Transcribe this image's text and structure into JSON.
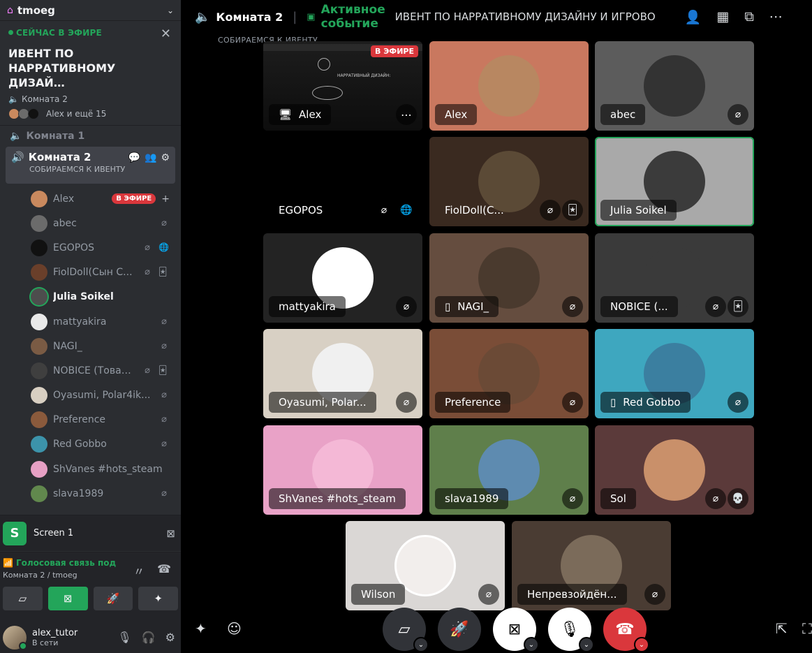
{
  "server": {
    "name": "tmoeg"
  },
  "live": {
    "tag": "СЕЙЧАС В ЭФИРЕ",
    "title": "ИВЕНТ ПО НАРРАТИВНОМУ ДИЗАЙ…",
    "room": "Комната 2",
    "people": "Alex и ещё 15"
  },
  "channels": {
    "room1": "Комната 1",
    "room2": {
      "name": "Комната 2",
      "status": "СОБИРАЕМСЯ К ИВЕНТУ"
    }
  },
  "members": [
    {
      "name": "Alex",
      "live_label": "В ЭФИРЕ",
      "color": "#c9895e"
    },
    {
      "name": "abec",
      "color": "#6b6b6b"
    },
    {
      "name": "EGOPOS",
      "color": "#111111"
    },
    {
      "name": "FiolDoll(Сын С...",
      "color": "#6a3f2a"
    },
    {
      "name": "Julia Soikel",
      "color": "#4d4d4d"
    },
    {
      "name": "mattyakira",
      "color": "#e9e9e9"
    },
    {
      "name": "NAGI_",
      "color": "#7a5b44"
    },
    {
      "name": "NOBICE (Товар...",
      "color": "#3f3f3f"
    },
    {
      "name": "Oyasumi, Polar4ik...",
      "color": "#d8cfc2"
    },
    {
      "name": "Preference",
      "color": "#8a5a3c"
    },
    {
      "name": "Red Gobbo",
      "color": "#3c93aa"
    },
    {
      "name": "ShVanes #hots_steam",
      "color": "#e6a0c4"
    },
    {
      "name": "slava1989",
      "color": "#61884d"
    }
  ],
  "screen_share": {
    "label": "Screen 1"
  },
  "voice": {
    "status": "Голосовая связь под",
    "location": "Комната 2 / tmoeg"
  },
  "user": {
    "name": "alex_tutor",
    "status": "В сети"
  },
  "topbar": {
    "room": "Комната 2",
    "event_label": "Активное событие",
    "event_name": "ИВЕНТ ПО НАРРАТИВНОМУ ДИЗАЙНУ И ИГРОВО",
    "subtitle": "СОБИРАЕМСЯ К ИВЕНТУ"
  },
  "tiles": [
    {
      "name": "Alex",
      "type": "screen",
      "live_label": "В ЭФИРЕ"
    },
    {
      "name": "Alex",
      "bg": "#c9785f",
      "av": "#b88761"
    },
    {
      "name": "abec",
      "bg": "#5c5c5c",
      "av": "#333333"
    },
    {
      "name": "EGOPOS",
      "bg": "#000000",
      "av": "#000000"
    },
    {
      "name": "FiolDoll(C...",
      "bg": "#3a2a20",
      "av": "#5b4a36"
    },
    {
      "name": "Julia Soikel",
      "bg": "#a9a9a9",
      "av": "#3b3b3b"
    },
    {
      "name": "mattyakira",
      "bg": "#232323",
      "av": "#ffffff"
    },
    {
      "name": "NAGI_",
      "bg": "#654d3f",
      "av": "#4a3a2e"
    },
    {
      "name": "NOBICE (...",
      "bg": "#3a3a3a",
      "av": "#3a3a3a"
    },
    {
      "name": "Oyasumi, Polar...",
      "bg": "#d8d0c4",
      "av": "#f0f0f0"
    },
    {
      "name": "Preference",
      "bg": "#7a4d37",
      "av": "#6b4a36"
    },
    {
      "name": "Red Gobbo",
      "bg": "#3ea7bf",
      "av": "#3b7fa0"
    },
    {
      "name": "ShVanes #hots_steam",
      "bg": "#e9a2c7",
      "av": "#e9a2c7"
    },
    {
      "name": "slava1989",
      "bg": "#5f7f4b",
      "av": "#5e8bb0"
    },
    {
      "name": "Sol",
      "bg": "#5b3a3a",
      "av": "#c9906a"
    },
    {
      "name": "Wilson",
      "bg": "#dad7d5",
      "av": "#f2eeec"
    },
    {
      "name": "Непревзойдён...",
      "bg": "#4a3c33",
      "av": "#7b6b5a"
    }
  ],
  "icons": {
    "mic_off": "mic-off-icon",
    "speaker": "speaker-icon"
  }
}
